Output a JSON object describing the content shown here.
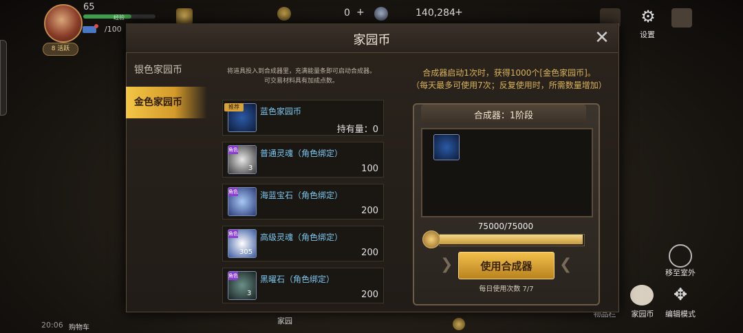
{
  "hud": {
    "level": "65",
    "exp_label": "经验",
    "energy_prefix": "/100",
    "energy_current": "",
    "vip_label": "8 活跃",
    "resource1": "0",
    "resource2": "140,284",
    "time": "20:06",
    "bottom_small": "购物车",
    "settings_label": "设置",
    "move_outdoor_label": "移至室外",
    "toolbar_label": "物品栏",
    "home_coin_label": "家园币",
    "edit_mode_label": "编辑模式",
    "home_label": "家园"
  },
  "dialog": {
    "title": "家园币",
    "tabs": [
      {
        "label": "银色家园币"
      },
      {
        "label": "金色家园币"
      }
    ],
    "description_line1": "将道具投入到合成器里，充满能量条即可启动合成器。",
    "description_line2": "可交易材料具有加成点数。",
    "recommend_badge": "推荐",
    "role_badge": "角色",
    "items": [
      {
        "name": "蓝色家园币",
        "count": "持有量：0",
        "qty": ""
      },
      {
        "name": "普通灵魂（角色绑定）",
        "count": "100",
        "qty": "3"
      },
      {
        "name": "海蓝宝石（角色绑定）",
        "count": "200",
        "qty": ""
      },
      {
        "name": "高级灵魂（角色绑定）",
        "count": "200",
        "qty": "305"
      },
      {
        "name": "黑曜石（角色绑定）",
        "count": "200",
        "qty": "3"
      }
    ],
    "info_line1": "合成器启动1次时，获得1000个[金色家园币]。",
    "info_line2": "（每天最多可使用7次；反复使用时，所需数量增加）",
    "machine_title": "合成器：1阶段",
    "progress_text": "75000/75000",
    "progress_fraction": 1.0,
    "use_button": "使用合成器",
    "daily_uses": "每日使用次数 7/7"
  },
  "colors": {
    "accent_gold": "#f2c04a",
    "item_name": "#7cc8f0",
    "info_text": "#d9b35b"
  }
}
